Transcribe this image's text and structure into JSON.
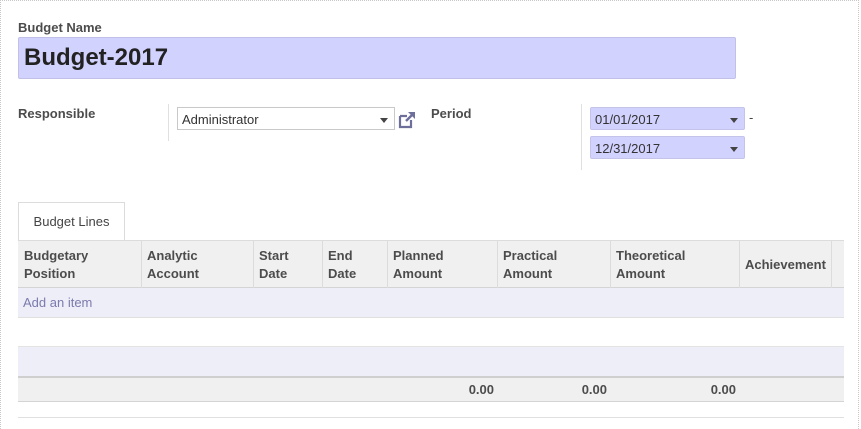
{
  "form": {
    "budget_name_label": "Budget Name",
    "budget_name_value": "Budget-2017",
    "responsible_label": "Responsible",
    "responsible_value": "Administrator",
    "period_label": "Period",
    "period_start": "01/01/2017",
    "period_end": "12/31/2017",
    "period_separator": "-"
  },
  "tabs": [
    {
      "label": "Budget Lines",
      "active": true
    }
  ],
  "table": {
    "columns": [
      [
        "Budgetary",
        "Position"
      ],
      [
        "Analytic",
        "Account"
      ],
      [
        "Start",
        "Date"
      ],
      [
        "End",
        "Date"
      ],
      [
        "Planned",
        "Amount"
      ],
      [
        "Practical",
        "Amount"
      ],
      [
        "Theoretical",
        "Amount"
      ],
      [
        "Achievement"
      ]
    ],
    "add_item_label": "Add an item",
    "totals": {
      "planned": "0.00",
      "practical": "0.00",
      "theoretical": "0.00"
    }
  },
  "colors": {
    "required_field": "#d2d2ff",
    "link": "#7c7bad",
    "header_bg": "#f0f0f0"
  },
  "icons": {
    "responsible_external": "external-link-icon",
    "dropdown": "caret-down-icon"
  }
}
